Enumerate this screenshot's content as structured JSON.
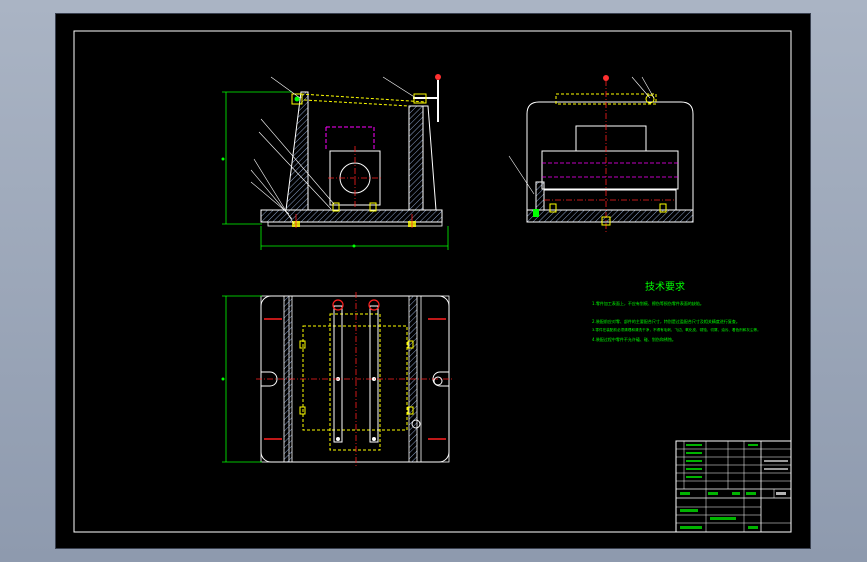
{
  "drawing": {
    "tech_title": "技术要求",
    "tech_notes": [
      "1.零件加工表面上，不应有划痕、擦伤等损伤零件表面的缺陷。",
      "2.装配前应对零、部件的主要配合尺寸，特别是过盈配合尺寸及相关精度进行复查。",
      "3.零件在装配前必须清理和清洗干净，不得有毛刺、飞边、氧化皮、锈蚀、切屑、油污、着色剂和灰尘等。",
      "4.装配过程中零件不允许磕、碰、划伤和锈蚀。"
    ],
    "colors": {
      "background": "#000000",
      "outline": "#ffffff",
      "hatch": "#8aa0c8",
      "hidden": "#ffff00",
      "center": "#ff2020",
      "dimension": "#00ff00",
      "phantom": "#ff00ff",
      "text": "#00ff00",
      "frame": "#ffffff"
    }
  }
}
